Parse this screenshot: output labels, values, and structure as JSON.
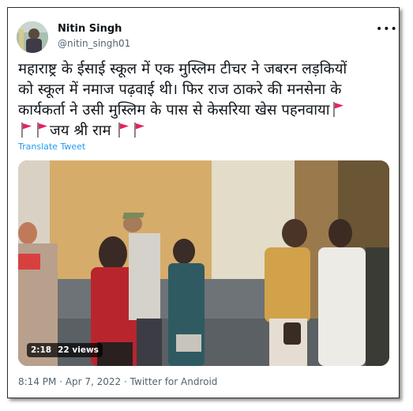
{
  "author": {
    "display_name": "Nitin Singh",
    "handle": "@nitin_singh01",
    "avatar_icon": "avatar-photo-icon"
  },
  "more_icon": "more-options-icon",
  "more_glyph": "•••",
  "tweet": {
    "line1": "महाराष्ट्र के ईसाई स्कूल में  एक मुस्लिम टीचर ने जबरन  लड़कियों",
    "line2": "को स्कूल में नमाज पढ़वाई थी। फिर राज ठाकरे की मनसेना के",
    "line3": "कार्यकर्ता ने उसी मुस्लिम के पास से केसरिया खेस पहनवाया",
    "line4_text": "जय श्री राम",
    "flag_icon": "red-flag-icon",
    "flag_color": "#e0245e"
  },
  "translate_label": "Translate Tweet",
  "video": {
    "duration": "2:18",
    "views": "22 views"
  },
  "meta": {
    "time": "8:14 PM",
    "separator": " · ",
    "date": "Apr 7, 2022",
    "source": "Twitter for Android"
  },
  "colors": {
    "link": "#1d9bf0",
    "secondary_text": "#536471",
    "primary_text": "#0f1419"
  }
}
